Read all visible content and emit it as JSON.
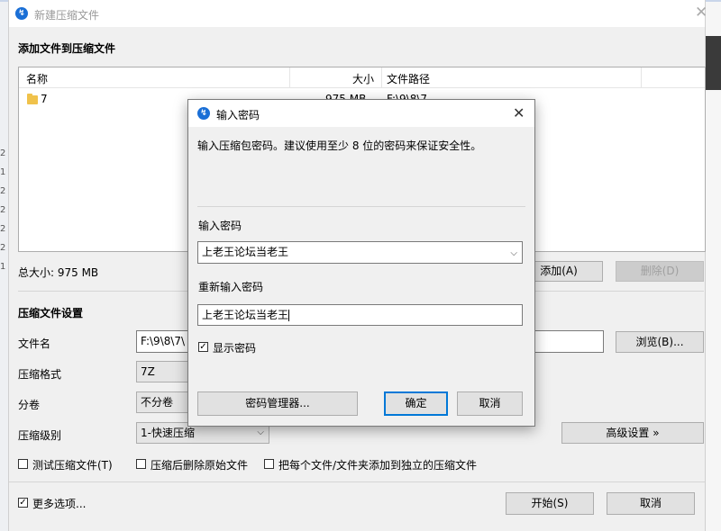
{
  "background": {
    "gutter_numbers": [
      "2",
      "1",
      "2",
      "2",
      "2",
      "2",
      "1"
    ]
  },
  "main_window": {
    "title": "新建压缩文件",
    "add_section_title": "添加文件到压缩文件",
    "file_list": {
      "columns": [
        "名称",
        "大小",
        "文件路径"
      ],
      "rows": [
        {
          "name": "7",
          "size": "975 MB",
          "path": "F:\\9\\8\\7"
        }
      ]
    },
    "total_size": "总大小: 975 MB",
    "add_button": "添加(A)",
    "delete_button": "删除(D)",
    "settings_title": "压缩文件设置",
    "filename_label": "文件名",
    "filename_value": "F:\\9\\8\\7\\",
    "browse_button": "浏览(B)...",
    "format_label": "压缩格式",
    "format_value": "7Z",
    "split_label": "分卷",
    "split_value": "不分卷",
    "level_label": "压缩级别",
    "level_value": "1-快速压缩",
    "advanced_button": "高级设置 »",
    "test_checkbox": "测试压缩文件(T)",
    "delete_after_checkbox": "压缩后删除原始文件",
    "separate_checkbox": "把每个文件/文件夹添加到独立的压缩文件",
    "more_options_checkbox": "更多选项...",
    "start_button": "开始(S)",
    "cancel_button": "取消"
  },
  "password_dialog": {
    "title": "输入密码",
    "description": "输入压缩包密码。建议使用至少 8 位的密码来保证安全性。",
    "password_label": "输入密码",
    "password_value": "上老王论坛当老王",
    "reenter_label": "重新输入密码",
    "reenter_value": "上老王论坛当老王",
    "show_password_checkbox": "显示密码",
    "manager_button": "密码管理器...",
    "ok_button": "确定",
    "cancel_button": "取消"
  },
  "colors": {
    "accent": "#0078d7",
    "logo": "#1a6fd6",
    "folder": "#f0c24b"
  }
}
